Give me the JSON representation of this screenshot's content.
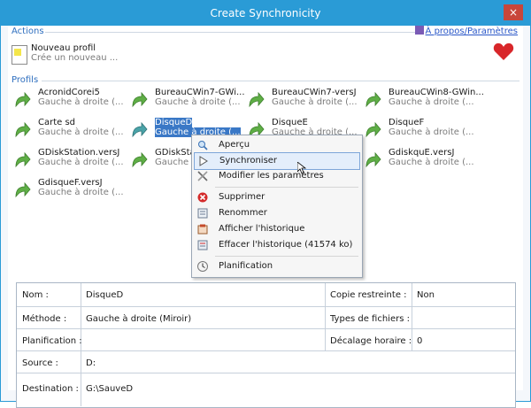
{
  "window": {
    "title": "Create Synchronicity",
    "close_label": "×"
  },
  "sections": {
    "actions": "Actions",
    "profiles": "Profils"
  },
  "about_link": "À propos/Paramètres",
  "new_profile": {
    "title": "Nouveau profil",
    "subtitle": "Crée un nouveau ..."
  },
  "profiles": [
    {
      "name": "AcronidCorei5",
      "desc": "Gauche à droite (..."
    },
    {
      "name": "BureauCWin7-GWi...",
      "desc": "Gauche à droite (..."
    },
    {
      "name": "BureauCWin7-versJ",
      "desc": "Gauche à droite (..."
    },
    {
      "name": "BureauCWin8-GWin...",
      "desc": "Gauche à droite (..."
    },
    {
      "name": "Carte sd",
      "desc": "Gauche à droite (..."
    },
    {
      "name": "DisqueD",
      "desc": "Gauche à droite (...",
      "selected": true
    },
    {
      "name": "DisqueE",
      "desc": "Gauche à droite (..."
    },
    {
      "name": "DisqueF",
      "desc": "Gauche à droite (..."
    },
    {
      "name": "GDiskStation.versJ",
      "desc": "Gauche à droite (..."
    },
    {
      "name": "GDiskSta",
      "desc": "Gauche à d"
    },
    {
      "name": "",
      "desc": ""
    },
    {
      "name": "GdiskquE.versJ",
      "desc": "Gauche à droite (..."
    },
    {
      "name": "GdisqueF.versJ",
      "desc": "Gauche à droite (..."
    }
  ],
  "context_menu": [
    {
      "label": "Aperçu",
      "icon": "magnifier-icon"
    },
    {
      "label": "Synchroniser",
      "icon": "play-icon",
      "highlighted": true
    },
    {
      "label": "Modifier les paramètres",
      "icon": "tools-icon"
    },
    {
      "label": "Supprimer",
      "icon": "delete-icon"
    },
    {
      "label": "Renommer",
      "icon": "rename-icon"
    },
    {
      "label": "Afficher l'historique",
      "icon": "history-icon"
    },
    {
      "label": "Effacer l'historique (41574 ko)",
      "icon": "clear-history-icon"
    },
    {
      "label": "Planification",
      "icon": "clock-icon"
    }
  ],
  "details": {
    "name_label": "Nom :",
    "name_value": "DisqueD",
    "copy_label": "Copie restreinte :",
    "copy_value": "Non",
    "method_label": "Méthode :",
    "method_value": "Gauche à droite (Miroir)",
    "types_label": "Types de fichiers :",
    "types_value": "",
    "plan_label": "Planification :",
    "plan_value": "",
    "offset_label": "Décalage horaire :",
    "offset_value": "0",
    "source_label": "Source :",
    "source_value": "D:",
    "dest_label": "Destination :",
    "dest_value": "G:\\SauveD"
  }
}
